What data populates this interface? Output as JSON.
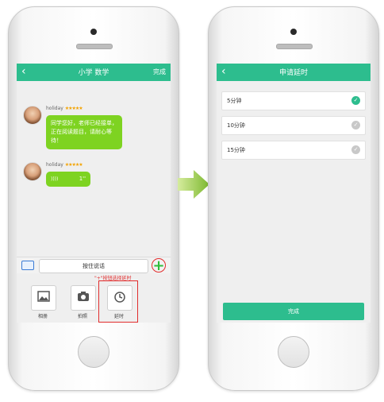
{
  "left_phone": {
    "navbar": {
      "back": "‹",
      "title": "小学 数学",
      "done": "完成"
    },
    "messages": [
      {
        "name": "holiday",
        "stars": "★★★★★",
        "text": "同学您好，老师已经接单，正在阅读题目，请耐心等待！"
      },
      {
        "name": "holiday",
        "stars": "★★★★★",
        "voice_icon": "))))",
        "duration": "1''"
      }
    ],
    "input": {
      "hold_label": "按住说话",
      "plus": "+",
      "keyboard_icon": "keyboard-icon"
    },
    "hint": "\"+\"按钮选择延时",
    "tools": [
      {
        "label": "相册",
        "icon": "image-icon"
      },
      {
        "label": "拍照",
        "icon": "camera-icon"
      },
      {
        "label": "延时",
        "icon": "clock-icon"
      }
    ]
  },
  "right_phone": {
    "navbar": {
      "back": "‹",
      "title": "申请延时"
    },
    "options": [
      {
        "label": "5分钟",
        "selected": true
      },
      {
        "label": "10分钟",
        "selected": false
      },
      {
        "label": "15分钟",
        "selected": false
      }
    ],
    "done_button": "完成"
  },
  "colors": {
    "brand": "#2dbd8e",
    "bubble": "#7ed321",
    "annotation": "#e12d2d",
    "selected": "#2dbd8e",
    "unselected": "#c8c8c8"
  }
}
